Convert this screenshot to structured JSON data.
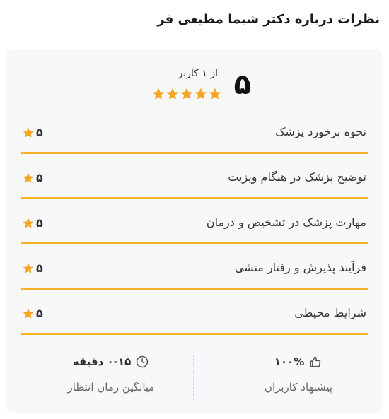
{
  "page": {
    "title": "نظرات درباره دکتر شیما مطیعی فر"
  },
  "summary": {
    "score": "۵",
    "from_users": "از ۱ کاربر",
    "stars": 5
  },
  "criteria": [
    {
      "label": "نحوه برخورد پزشک",
      "score": "۵"
    },
    {
      "label": "توضیح پزشک در هنگام ویزیت",
      "score": "۵"
    },
    {
      "label": "مهارت پزشک در تشخیص و درمان",
      "score": "۵"
    },
    {
      "label": "فرآیند پذیرش و رفتار منشی",
      "score": "۵"
    },
    {
      "label": "شرایط محیطی",
      "score": "۵"
    }
  ],
  "stats": {
    "recommendation": {
      "value": "۱۰۰%",
      "label": "پیشنهاد کاربران",
      "icon": "thumbs-up-icon"
    },
    "wait_time": {
      "value": "۰-۱۵ دقیقه",
      "label": "میانگین زمان انتظار",
      "icon": "clock-icon"
    }
  },
  "colors": {
    "star": "#f6a623",
    "row_border": "#f6b42a",
    "card_bg": "#f7f8fa"
  }
}
